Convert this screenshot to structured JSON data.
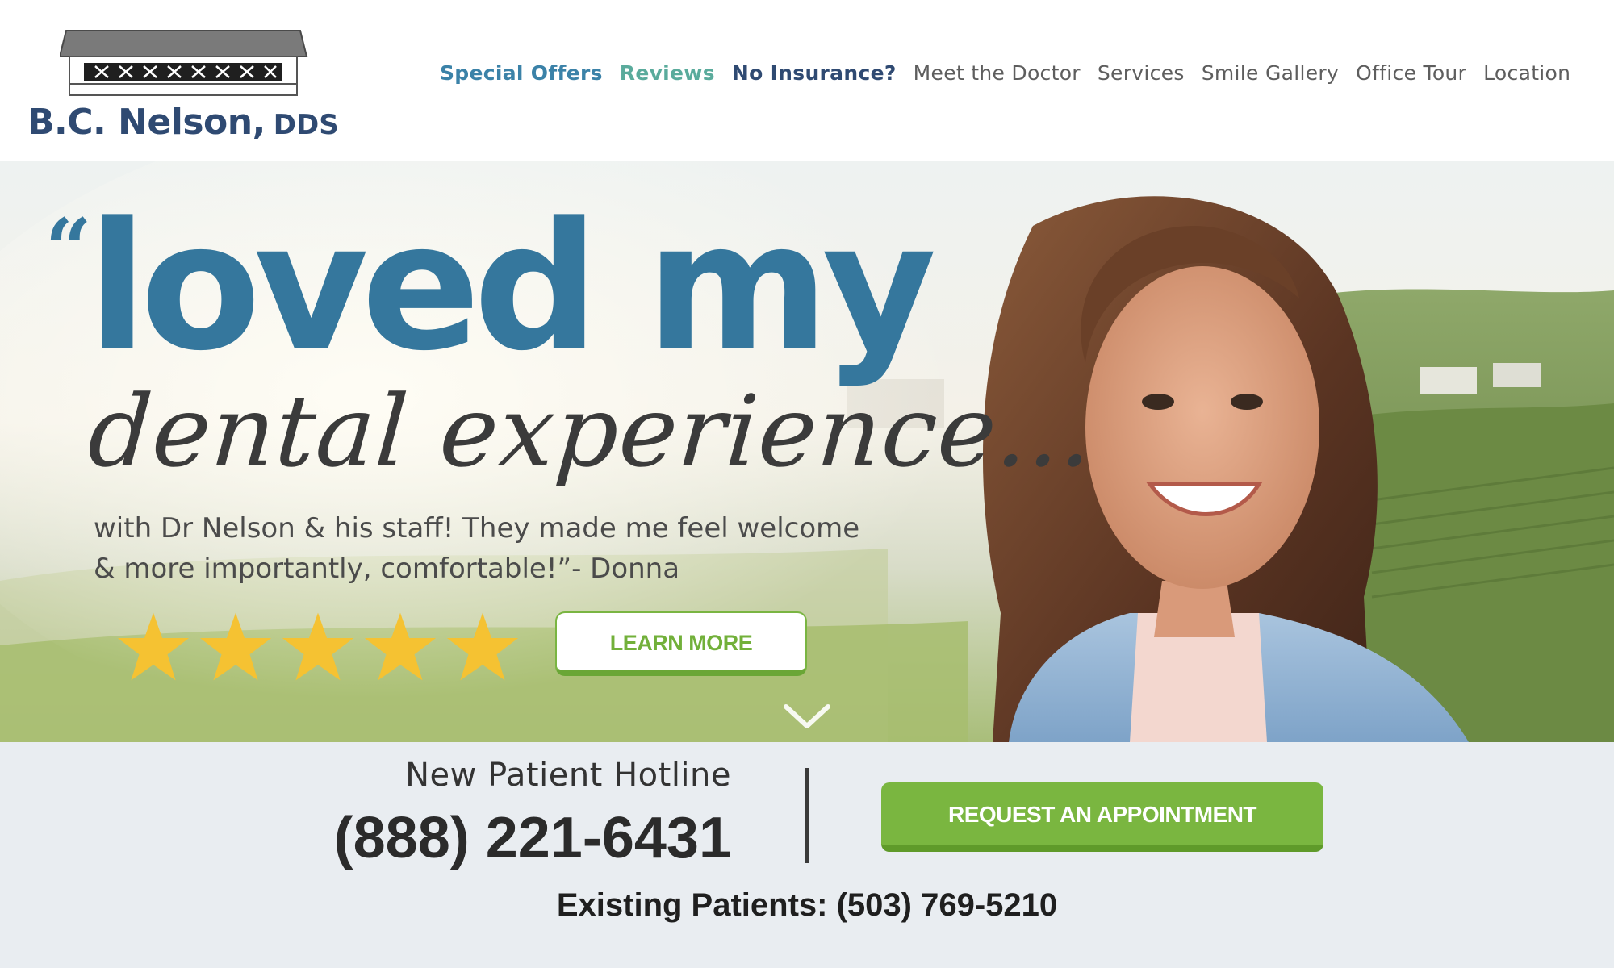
{
  "brand": {
    "name": "B.C. Nelson,",
    "suffix": "DDS",
    "color": "#2f4a72"
  },
  "nav": {
    "items": [
      {
        "label": "Special Offers",
        "color": "#3b82a8"
      },
      {
        "label": "Reviews",
        "color": "#5aab9c"
      },
      {
        "label": "No Insurance?",
        "color": "#2f4a72"
      },
      {
        "label": "Meet the Doctor",
        "color": "#5e5e5e"
      },
      {
        "label": "Services",
        "color": "#5e5e5e"
      },
      {
        "label": "Smile Gallery",
        "color": "#5e5e5e"
      },
      {
        "label": "Office Tour",
        "color": "#5e5e5e"
      },
      {
        "label": "Location",
        "color": "#5e5e5e"
      }
    ]
  },
  "hero": {
    "quote_mark": "“",
    "headline": "loved my",
    "headline_script": "dental experience...",
    "testimonial": "with Dr Nelson & his staff! They made me feel welcome & more importantly, comfortable!”- Donna",
    "rating": 5,
    "learn_more_label": "LEARN MORE",
    "accent_color": "#35779d",
    "star_color": "#f5c232"
  },
  "contact": {
    "hotline_label": "New Patient Hotline",
    "hotline_number": "(888) 221-6431",
    "request_label": "REQUEST AN APPOINTMENT",
    "existing_patients": "Existing Patients: (503) 769-5210",
    "button_color": "#7ab640"
  }
}
